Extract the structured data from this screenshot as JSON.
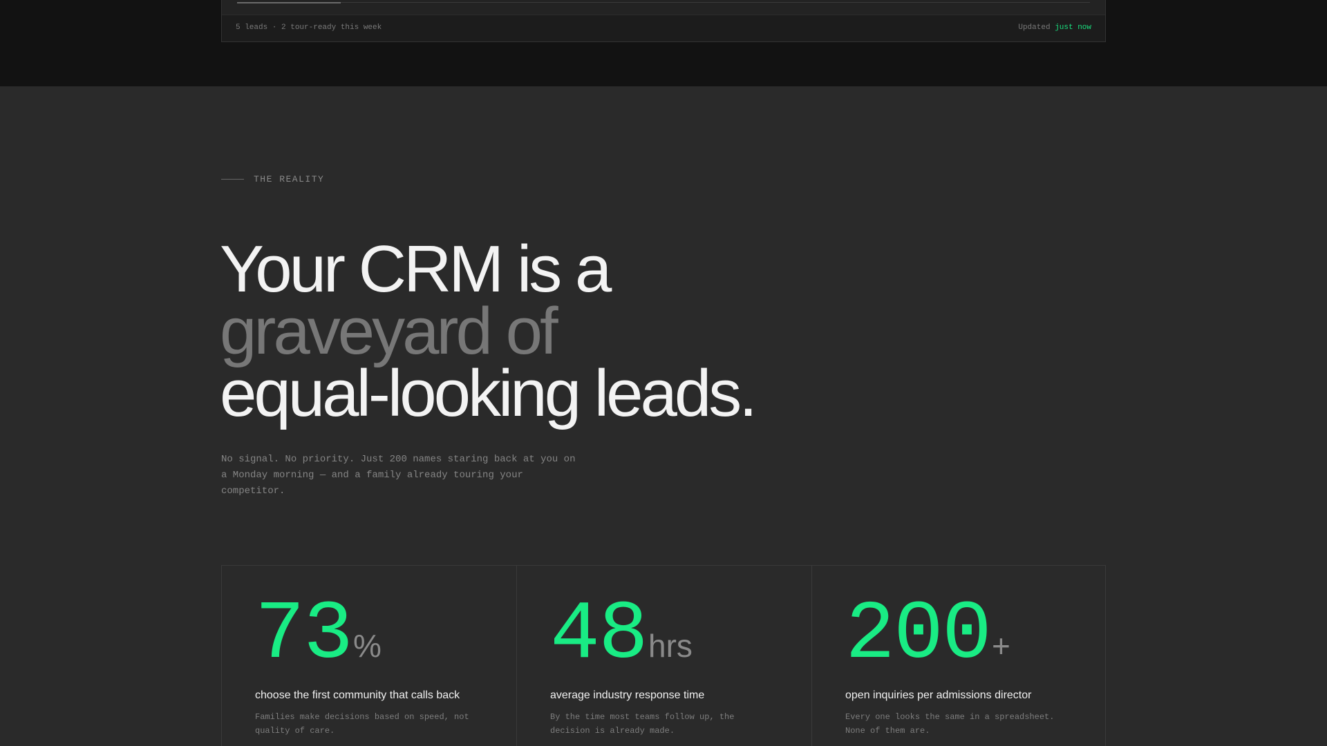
{
  "widget": {
    "summary": "5 leads · 2 tour-ready this week",
    "updated_label": "Updated",
    "updated_value": "just now"
  },
  "section": {
    "eyebrow": "THE REALITY",
    "headline": {
      "line1": "Your CRM is a",
      "line2": "graveyard of",
      "line3": "equal-looking leads."
    },
    "subcopy": "No signal. No priority. Just 200 names staring back at you on a Monday morning — and a family already touring your competitor."
  },
  "stats": [
    {
      "value": "73",
      "unit": "%",
      "title": "choose the first community that calls back",
      "description": "Families make decisions based on speed, not quality of care."
    },
    {
      "value": "48",
      "unit": "hrs",
      "title": "average industry response time",
      "description": "By the time most teams follow up, the decision is already made."
    },
    {
      "value": "200",
      "unit": "+",
      "title": "open inquiries per admissions director",
      "description": "Every one looks the same in a spreadsheet. None of them are."
    }
  ],
  "colors": {
    "accent": "#19ec84",
    "background": "#2a2a2a",
    "band": "#121212"
  }
}
